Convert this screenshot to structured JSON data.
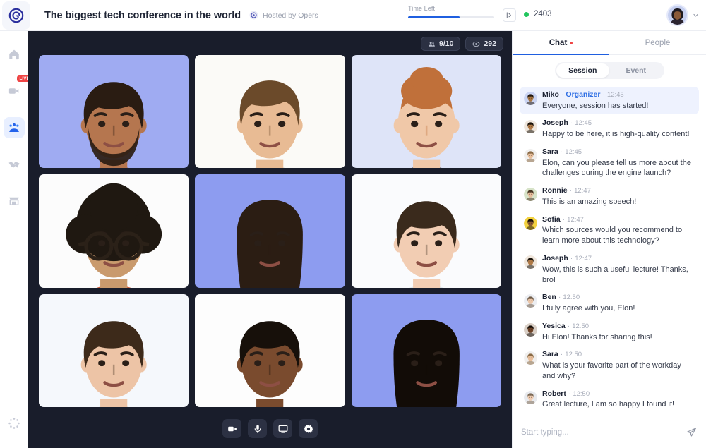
{
  "header": {
    "logo_icon": "spiral-logo-icon",
    "event_title": "The biggest tech conference in the world",
    "host_icon": "opers-logo-icon",
    "host_label": "Hosted by Opers",
    "time_left_label": "Time Left",
    "time_left_percent": 60,
    "collapse_icon": "collapse-panel-icon",
    "online_count": "2403",
    "online_status_color": "#22c55e",
    "user_avatar_icon": "user-avatar",
    "user_menu_chevron_icon": "chevron-down-icon"
  },
  "sidebar": {
    "items": [
      {
        "icon": "home-icon",
        "name": "home",
        "active": false,
        "badge": null
      },
      {
        "icon": "video-camera-icon",
        "name": "live-sessions",
        "active": false,
        "badge": "LIVE"
      },
      {
        "icon": "people-group-icon",
        "name": "networking",
        "active": true,
        "badge": null
      },
      {
        "icon": "handshake-icon",
        "name": "sponsors",
        "active": false,
        "badge": null
      },
      {
        "icon": "expo-booth-icon",
        "name": "expo",
        "active": false,
        "badge": null
      }
    ],
    "bottom_item": {
      "icon": "settings-spinner-icon",
      "name": "settings"
    }
  },
  "stage": {
    "participants_icon": "participants-icon",
    "participants_count": "9/10",
    "viewers_icon": "eye-icon",
    "viewers_count": "292",
    "tiles": [
      {
        "name": "participant-tile-1",
        "bg": "#9fabf2",
        "skin": "#b5764f",
        "hair": "#2a1c12",
        "shirt": "#a9675a",
        "hair_style": "short",
        "beard": true,
        "glasses": false,
        "long_hair": false
      },
      {
        "name": "participant-tile-2",
        "bg": "#fbfaf7",
        "skin": "#e8bb94",
        "hair": "#6b4a2a",
        "shirt": "#ded7cc",
        "hair_style": "swoop",
        "beard": false,
        "glasses": false,
        "long_hair": false
      },
      {
        "name": "participant-tile-3",
        "bg": "#dee4f8",
        "skin": "#f0c8a8",
        "hair": "#c0703a",
        "shirt": "#3a3c48",
        "hair_style": "updo",
        "beard": false,
        "glasses": false,
        "long_hair": false
      },
      {
        "name": "participant-tile-4",
        "bg": "#fcfcfc",
        "skin": "#c99a6d",
        "hair": "#1f1811",
        "shirt": "#cf5b3a",
        "hair_style": "afro",
        "beard": false,
        "glasses": true,
        "long_hair": false
      },
      {
        "name": "participant-tile-5",
        "bg": "#8d9cf0",
        "skin": "#e3b68c",
        "hair": "#2b1d13",
        "shirt": "#9b9185",
        "hair_style": "long",
        "beard": false,
        "glasses": false,
        "long_hair": true
      },
      {
        "name": "participant-tile-6",
        "bg": "#fafbfd",
        "skin": "#f2cdb3",
        "hair": "#3a2a1c",
        "shirt": "#dfe8ee",
        "hair_style": "short",
        "beard": false,
        "glasses": false,
        "long_hair": false
      },
      {
        "name": "participant-tile-7",
        "bg": "#f5f8fc",
        "skin": "#edc4a6",
        "hair": "#3d2a1a",
        "shirt": "#d3dde6",
        "hair_style": "short",
        "beard": false,
        "glasses": false,
        "long_hair": false
      },
      {
        "name": "participant-tile-8",
        "bg": "#fdfdfd",
        "skin": "#7a4b2e",
        "hair": "#17100a",
        "shirt": "#ffffff",
        "hair_style": "short",
        "beard": false,
        "glasses": false,
        "long_hair": false
      },
      {
        "name": "participant-tile-9",
        "bg": "#8d9cf0",
        "skin": "#5d3a22",
        "hair": "#120c07",
        "shirt": "#f2c12e",
        "hair_style": "long",
        "beard": false,
        "glasses": false,
        "long_hair": true
      }
    ],
    "controls": [
      {
        "icon": "video-camera-icon",
        "name": "toggle-camera-button"
      },
      {
        "icon": "microphone-icon",
        "name": "toggle-microphone-button"
      },
      {
        "icon": "screen-share-icon",
        "name": "share-screen-button"
      },
      {
        "icon": "settings-gear-icon",
        "name": "settings-button"
      }
    ]
  },
  "chat": {
    "tabs": [
      {
        "label": "Chat",
        "active": true,
        "unread": true
      },
      {
        "label": "People",
        "active": false,
        "unread": false
      }
    ],
    "segments": [
      {
        "label": "Session",
        "active": true
      },
      {
        "label": "Event",
        "active": false
      }
    ],
    "messages": [
      {
        "author": "Miko",
        "role": "Organizer",
        "time": "12:45",
        "text": "Everyone, session has started!",
        "highlight": true,
        "avatar_skin": "#a6743f",
        "avatar_hair": "#241a10",
        "avatar_bg": "#c9d3f2"
      },
      {
        "author": "Joseph",
        "role": null,
        "time": "12:45",
        "text": "Happy to be here, it is high-quality content!",
        "highlight": false,
        "avatar_skin": "#b07a46",
        "avatar_hair": "#1a1209",
        "avatar_bg": "#efe6dc"
      },
      {
        "author": "Sara",
        "role": null,
        "time": "12:45",
        "text": "Elon, can you please tell us more about the challenges during the engine launch?",
        "highlight": false,
        "avatar_skin": "#e8bf9c",
        "avatar_hair": "#8a6a45",
        "avatar_bg": "#f0efee"
      },
      {
        "author": "Ronnie",
        "role": null,
        "time": "12:47",
        "text": "This is an amazing speech!",
        "highlight": false,
        "avatar_skin": "#e7bd9b",
        "avatar_hair": "#4a3824",
        "avatar_bg": "#d7e3c8"
      },
      {
        "author": "Sofia",
        "role": null,
        "time": "12:47",
        "text": "Which sources would you recommend to learn more about this technology?",
        "highlight": false,
        "avatar_skin": "#8a5a33",
        "avatar_hair": "#1c120a",
        "avatar_bg": "#f3d23f"
      },
      {
        "author": "Joseph",
        "role": null,
        "time": "12:47",
        "text": "Wow, this is such a useful lecture! Thanks, bro!",
        "highlight": false,
        "avatar_skin": "#b07a46",
        "avatar_hair": "#1a1209",
        "avatar_bg": "#efe6dc"
      },
      {
        "author": "Ben",
        "role": null,
        "time": "12:50",
        "text": "I fully agree with you, Elon!",
        "highlight": false,
        "avatar_skin": "#ecc6a8",
        "avatar_hair": "#6d5a46",
        "avatar_bg": "#eceef2"
      },
      {
        "author": "Yesica",
        "role": null,
        "time": "12:50",
        "text": "Hi Elon! Thanks for sharing this!",
        "highlight": false,
        "avatar_skin": "#6e4226",
        "avatar_hair": "#140d07",
        "avatar_bg": "#d9cfc6"
      },
      {
        "author": "Sara",
        "role": null,
        "time": "12:50",
        "text": "What is your favorite part of the workday and why?",
        "highlight": false,
        "avatar_skin": "#e8bf9c",
        "avatar_hair": "#8a6a45",
        "avatar_bg": "#f0efee"
      },
      {
        "author": "Robert",
        "role": null,
        "time": "12:50",
        "text": "Great lecture, I am so happy I found it!",
        "highlight": false,
        "avatar_skin": "#f0cdb2",
        "avatar_hair": "#7d6a56",
        "avatar_bg": "#e8eaee"
      }
    ],
    "composer": {
      "placeholder": "Start typing...",
      "value": "",
      "send_icon": "send-paper-plane-icon"
    }
  },
  "colors": {
    "accent": "#1f5fe0",
    "stage_bg": "#191d2b",
    "unread": "#ef4444",
    "online": "#22c55e"
  }
}
